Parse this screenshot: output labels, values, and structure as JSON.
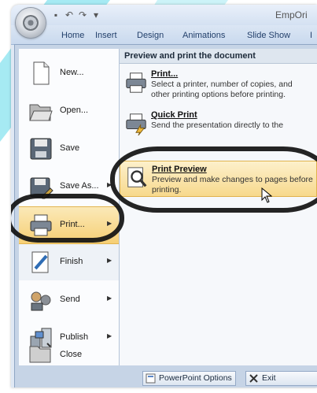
{
  "app": {
    "title": "EmpOri"
  },
  "ribbon": {
    "tabs": [
      "Home",
      "Insert",
      "Design",
      "Animations",
      "Slide Show",
      "I"
    ]
  },
  "menu": {
    "items": [
      {
        "label": "New...",
        "icon": "new-document-icon",
        "arrow": false
      },
      {
        "label": "Open...",
        "icon": "open-folder-icon",
        "arrow": false
      },
      {
        "label": "Save",
        "icon": "save-disk-icon",
        "arrow": false
      },
      {
        "label": "Save As...",
        "icon": "save-as-icon",
        "arrow": true
      },
      {
        "label": "Print...",
        "icon": "printer-icon",
        "arrow": true
      },
      {
        "label": "Finish",
        "icon": "finish-icon",
        "arrow": true
      },
      {
        "label": "Send",
        "icon": "send-icon",
        "arrow": true
      },
      {
        "label": "Publish",
        "icon": "publish-icon",
        "arrow": true
      },
      {
        "label": "Close",
        "icon": "close-folder-icon",
        "arrow": false
      }
    ]
  },
  "submenu": {
    "header": "Preview and print the document",
    "options": [
      {
        "title": "Print...",
        "desc": "Select a printer, number of copies, and other printing options before printing.",
        "icon": "printer-icon"
      },
      {
        "title": "Quick Print",
        "desc": "Send the presentation directly to the",
        "icon": "quick-print-icon"
      },
      {
        "title": "Print Preview",
        "desc": "Preview and make changes to pages before printing.",
        "icon": "print-preview-icon"
      }
    ]
  },
  "footer": {
    "options_label": "PowerPoint Options",
    "exit_label": "Exit PowerPoint"
  },
  "colors": {
    "highlight": "#f6cf74",
    "panel": "#c6d4e6",
    "watermark": "#00bcd4"
  }
}
